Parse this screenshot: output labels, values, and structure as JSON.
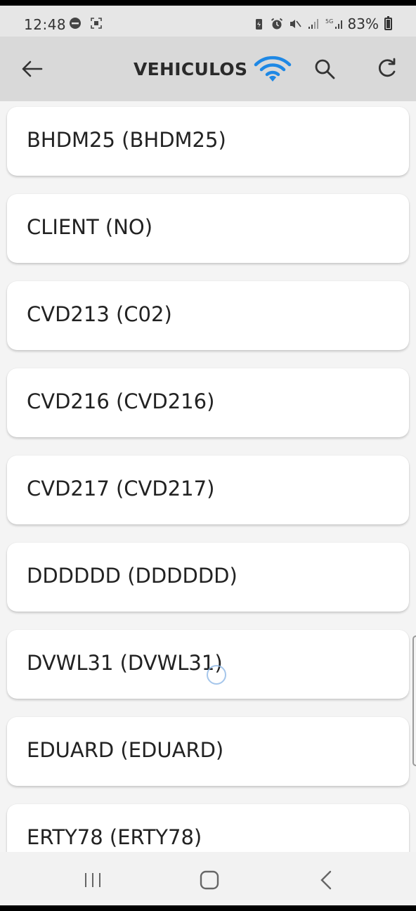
{
  "status_bar": {
    "time": "12:48",
    "battery_percent": "83%",
    "icons_left": [
      "do-not-disturb-icon",
      "screenshot-icon"
    ],
    "icons_right": [
      "battery-saver-icon",
      "alarm-icon",
      "mute-icon",
      "signal-icon",
      "5g-signal-icon"
    ]
  },
  "header": {
    "title": "VEHICULOS",
    "wifi_color": "#1e88e5"
  },
  "vehicles": [
    {
      "label": "BHDM25 (BHDM25)"
    },
    {
      "label": "CLIENT (NO)"
    },
    {
      "label": "CVD213 (C02)"
    },
    {
      "label": "CVD216 (CVD216)"
    },
    {
      "label": "CVD217 (CVD217)"
    },
    {
      "label": "DDDDDD (DDDDDD)"
    },
    {
      "label": "DVWL31 (DVWL31)"
    },
    {
      "label": "EDUARD (EDUARD)"
    },
    {
      "label": "ERTY78 (ERTY78)"
    }
  ]
}
